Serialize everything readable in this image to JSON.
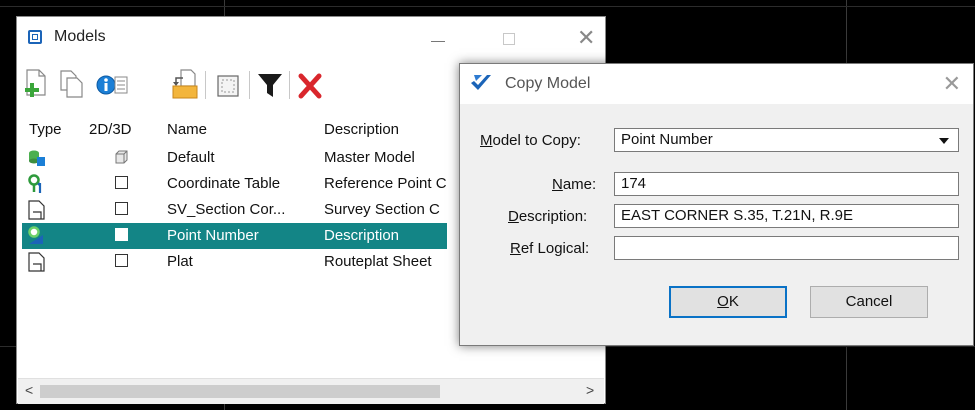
{
  "models_window": {
    "title": "Models",
    "columns": [
      "Type",
      "2D/3D",
      "Name",
      "Description"
    ],
    "rows": [
      {
        "type_icon": "3d-model-icon",
        "dim": "3d",
        "name": "Default",
        "description": "Master Model",
        "selected": false
      },
      {
        "type_icon": "point-table-icon",
        "dim": "2d",
        "name": "Coordinate Table",
        "description": "Reference Point C",
        "selected": false
      },
      {
        "type_icon": "sheet-icon",
        "dim": "2d",
        "name": "SV_Section Cor...",
        "description": "Survey Section C",
        "selected": false
      },
      {
        "type_icon": "point-number-icon",
        "dim": "2d",
        "name": "Point Number",
        "description": "Description",
        "selected": true
      },
      {
        "type_icon": "sheet-icon",
        "dim": "2d",
        "name": "Plat",
        "description": "Routeplat Sheet",
        "selected": false
      }
    ],
    "toolbar_icons": [
      "new-model-icon",
      "copy-model-icon",
      "properties-icon",
      "import-icon",
      "select-all-icon",
      "filter-icon",
      "delete-icon"
    ],
    "scroll_left": "<",
    "scroll_right": ">",
    "minimize": "—",
    "close": "✕"
  },
  "copy_dialog": {
    "title": "Copy Model",
    "close": "✕",
    "model_to_copy_label_u": "M",
    "model_to_copy_label_rest": "odel to Copy:",
    "model_to_copy_value": "Point Number",
    "name_label_u": "N",
    "name_label_rest": "ame:",
    "name_value": "174",
    "description_label_u": "D",
    "description_label_rest": "escription:",
    "description_value": "EAST CORNER S.35, T.21N, R.9E",
    "ref_logical_label_u": "R",
    "ref_logical_label_rest": "ef Logical:",
    "ref_logical_value": "",
    "ok_label_u": "O",
    "ok_label_rest": "K",
    "cancel_label": "Cancel"
  },
  "colors": {
    "selection": "#138586",
    "ok_border": "#0a72c6",
    "delete_red": "#d9262c"
  }
}
